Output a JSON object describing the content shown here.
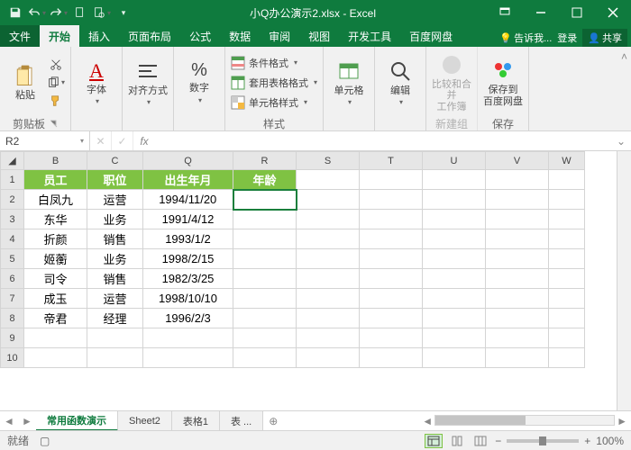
{
  "title": "小Q办公演示2.xlsx - Excel",
  "tabs": {
    "file": "文件",
    "home": "开始",
    "insert": "插入",
    "layout": "页面布局",
    "formula": "公式",
    "data": "数据",
    "review": "审阅",
    "view": "视图",
    "dev": "开发工具",
    "baidu": "百度网盘"
  },
  "tell": "告诉我...",
  "login": "登录",
  "share": "共享",
  "groups": {
    "clipboard": "剪贴板",
    "font": "字体",
    "align": "对齐方式",
    "number": "数字",
    "styles": "样式",
    "cells": "单元格",
    "editing": "编辑",
    "compare": "比较和合并\n工作簿",
    "newgroup": "新建组",
    "save": "保存到\n百度网盘",
    "savegroup": "保存"
  },
  "paste": "粘贴",
  "styleBtns": {
    "cond": "条件格式",
    "table": "套用表格格式",
    "cell": "单元格样式"
  },
  "cellRef": "R2",
  "cols": [
    "B",
    "C",
    "Q",
    "R",
    "S",
    "T",
    "U",
    "V",
    "W"
  ],
  "headerRow": {
    "emp": "员工",
    "pos": "职位",
    "birth": "出生年月",
    "age": "年龄"
  },
  "rows": [
    {
      "n": "2",
      "emp": "白凤九",
      "pos": "运营",
      "birth": "1994/11/20"
    },
    {
      "n": "3",
      "emp": "东华",
      "pos": "业务",
      "birth": "1991/4/12"
    },
    {
      "n": "4",
      "emp": "折颜",
      "pos": "销售",
      "birth": "1993/1/2"
    },
    {
      "n": "5",
      "emp": "姬蘅",
      "pos": "业务",
      "birth": "1998/2/15"
    },
    {
      "n": "6",
      "emp": "司令",
      "pos": "销售",
      "birth": "1982/3/25"
    },
    {
      "n": "7",
      "emp": "成玉",
      "pos": "运营",
      "birth": "1998/10/10"
    },
    {
      "n": "8",
      "emp": "帝君",
      "pos": "经理",
      "birth": "1996/2/3"
    }
  ],
  "sheets": {
    "s1": "常用函数演示",
    "s2": "Sheet2",
    "s3": "表格1",
    "s4": "表 ..."
  },
  "status": {
    "ready": "就绪",
    "zoom": "100%"
  }
}
